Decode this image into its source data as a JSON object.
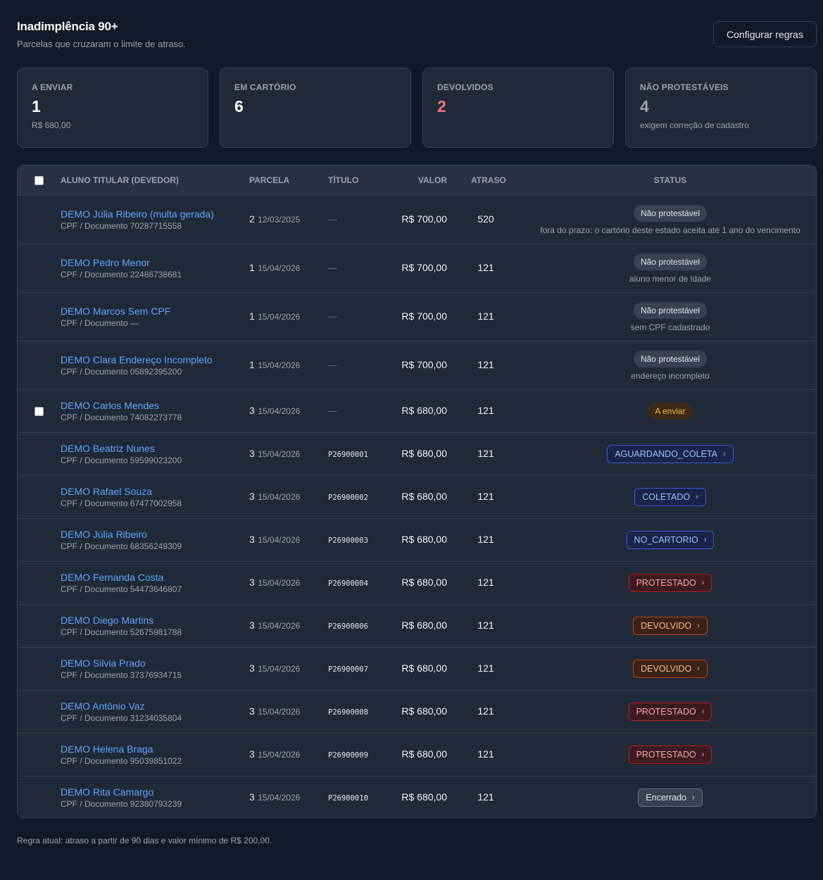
{
  "header": {
    "title": "Inadimplência 90+",
    "subtitle": "Parcelas que cruzaram o limite de atraso.",
    "config_button": "Configurar regras"
  },
  "cards": [
    {
      "label": "A ENVIAR",
      "value": "1",
      "note": "R$ 680,00"
    },
    {
      "label": "EM CARTÓRIO",
      "value": "6",
      "note": ""
    },
    {
      "label": "DEVOLVIDOS",
      "value": "2",
      "note": ""
    },
    {
      "label": "NÃO PROTESTÁVEIS",
      "value": "4",
      "note": "exigem correção de cadastro"
    }
  ],
  "table": {
    "columns": {
      "aluno": "ALUNO TITULAR (DEVEDOR)",
      "parcela": "PARCELA",
      "titulo": "TÍTULO",
      "valor": "VALOR",
      "atraso": "ATRASO",
      "status": "STATUS"
    },
    "rows": [
      {
        "name": "DEMO Júlia Ribeiro (multa gerada)",
        "doc": "CPF / Documento 70287715558",
        "parcela": "2",
        "date": "12/03/2025",
        "titulo": "—",
        "valor": "R$ 700,00",
        "atraso": "520",
        "status": "Não protestável",
        "status_note": "fora do prazo: o cartório deste estado aceita até 1 ano do vencimento",
        "kind": "plain",
        "checkbox": false
      },
      {
        "name": "DEMO Pedro Menor",
        "doc": "CPF / Documento 22486738681",
        "parcela": "1",
        "date": "15/04/2026",
        "titulo": "—",
        "valor": "R$ 700,00",
        "atraso": "121",
        "status": "Não protestável",
        "status_note": "aluno menor de idade",
        "kind": "plain",
        "checkbox": false
      },
      {
        "name": "DEMO Marcos Sem CPF",
        "doc": "CPF / Documento —",
        "parcela": "1",
        "date": "15/04/2026",
        "titulo": "—",
        "valor": "R$ 700,00",
        "atraso": "121",
        "status": "Não protestável",
        "status_note": "sem CPF cadastrado",
        "kind": "plain",
        "checkbox": false
      },
      {
        "name": "DEMO Clara Endereço Incompleto",
        "doc": "CPF / Documento 05892395200",
        "parcela": "1",
        "date": "15/04/2026",
        "titulo": "—",
        "valor": "R$ 700,00",
        "atraso": "121",
        "status": "Não protestável",
        "status_note": "endereço incompleto",
        "kind": "plain",
        "checkbox": false
      },
      {
        "name": "DEMO Carlos Mendes",
        "doc": "CPF / Documento 74082273778",
        "parcela": "3",
        "date": "15/04/2026",
        "titulo": "—",
        "valor": "R$ 680,00",
        "atraso": "121",
        "status": "A enviar",
        "status_note": "",
        "kind": "amber",
        "checkbox": true
      },
      {
        "name": "DEMO Beatriz Nunes",
        "doc": "CPF / Documento 59599023200",
        "parcela": "3",
        "date": "15/04/2026",
        "titulo": "P26900001",
        "valor": "R$ 680,00",
        "atraso": "121",
        "status": "AGUARDANDO_COLETA",
        "status_note": "",
        "kind": "blue",
        "checkbox": false
      },
      {
        "name": "DEMO Rafael Souza",
        "doc": "CPF / Documento 67477002958",
        "parcela": "3",
        "date": "15/04/2026",
        "titulo": "P26900002",
        "valor": "R$ 680,00",
        "atraso": "121",
        "status": "COLETADO",
        "status_note": "",
        "kind": "blue",
        "checkbox": false
      },
      {
        "name": "DEMO Júlia Ribeiro",
        "doc": "CPF / Documento 68356249309",
        "parcela": "3",
        "date": "15/04/2026",
        "titulo": "P26900003",
        "valor": "R$ 680,00",
        "atraso": "121",
        "status": "NO_CARTORIO",
        "status_note": "",
        "kind": "blue",
        "checkbox": false
      },
      {
        "name": "DEMO Fernanda Costa",
        "doc": "CPF / Documento 54473646807",
        "parcela": "3",
        "date": "15/04/2026",
        "titulo": "P26900004",
        "valor": "R$ 680,00",
        "atraso": "121",
        "status": "PROTESTADO",
        "status_note": "",
        "kind": "red",
        "checkbox": false
      },
      {
        "name": "DEMO Diego Martins",
        "doc": "CPF / Documento 52675981788",
        "parcela": "3",
        "date": "15/04/2026",
        "titulo": "P26900006",
        "valor": "R$ 680,00",
        "atraso": "121",
        "status": "DEVOLVIDO",
        "status_note": "",
        "kind": "orange",
        "checkbox": false
      },
      {
        "name": "DEMO Silvia Prado",
        "doc": "CPF / Documento 37376934715",
        "parcela": "3",
        "date": "15/04/2026",
        "titulo": "P26900007",
        "valor": "R$ 680,00",
        "atraso": "121",
        "status": "DEVOLVIDO",
        "status_note": "",
        "kind": "orange",
        "checkbox": false
      },
      {
        "name": "DEMO Antônio Vaz",
        "doc": "CPF / Documento 31234035804",
        "parcela": "3",
        "date": "15/04/2026",
        "titulo": "P26900008",
        "valor": "R$ 680,00",
        "atraso": "121",
        "status": "PROTESTADO",
        "status_note": "",
        "kind": "red",
        "checkbox": false
      },
      {
        "name": "DEMO Helena Braga",
        "doc": "CPF / Documento 95039851022",
        "parcela": "3",
        "date": "15/04/2026",
        "titulo": "P26900009",
        "valor": "R$ 680,00",
        "atraso": "121",
        "status": "PROTESTADO",
        "status_note": "",
        "kind": "red",
        "checkbox": false
      },
      {
        "name": "DEMO Rita Camargo",
        "doc": "CPF / Documento 92380793239",
        "parcela": "3",
        "date": "15/04/2026",
        "titulo": "P26900010",
        "valor": "R$ 680,00",
        "atraso": "121",
        "status": "Encerrado",
        "status_note": "",
        "kind": "gray",
        "checkbox": false
      }
    ]
  },
  "footer": {
    "rule_text": "Regra atual: atraso a partir de 90 dias e valor mínimo de R$ 200,00."
  },
  "colors": {
    "background": "#111827",
    "card": "#1f2937",
    "link": "#60a5fa",
    "red_value": "#f87171"
  },
  "icons": {
    "chevron": "chevron-right-icon"
  }
}
